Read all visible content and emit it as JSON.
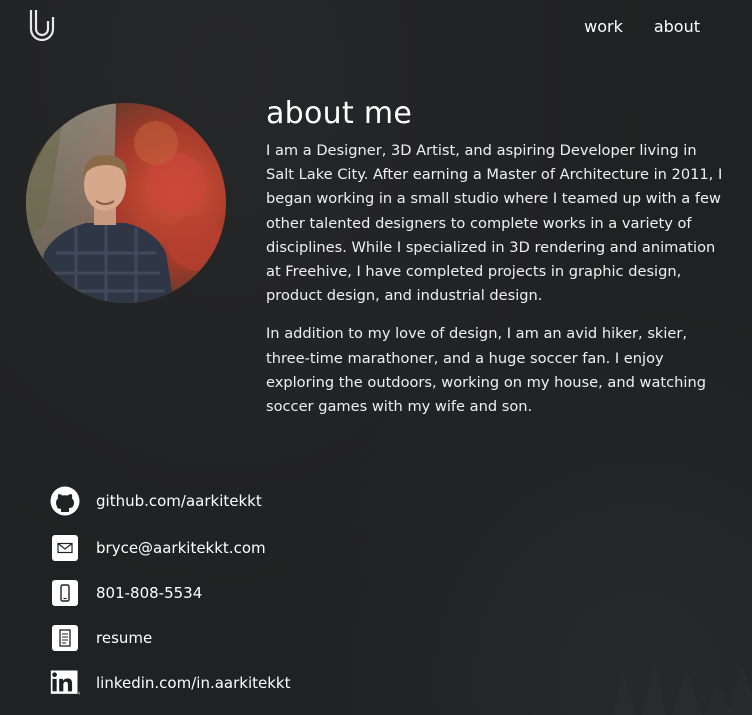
{
  "nav": {
    "logo": "aarkitekkt-logo",
    "links": [
      {
        "label": "work"
      },
      {
        "label": "about"
      }
    ]
  },
  "about": {
    "heading": "about me",
    "paragraphs": [
      "I am a Designer, 3D Artist, and aspiring Developer living in Salt Lake City. After earning a Master of Architecture in 2011, I began working in a small studio where I teamed up with a few other talented designers to complete works in a variety of disciplines. While I specialized in 3D rendering and animation at Freehive, I have completed projects in graphic design, product design, and industrial design.",
      "In addition to my love of design, I am an avid hiker, skier, three-time marathoner, and a huge soccer fan. I enjoy exploring the outdoors, working on my house, and watching soccer games with my wife and son."
    ]
  },
  "contacts": [
    {
      "icon": "github-icon",
      "label": "github.com/aarkitekkt"
    },
    {
      "icon": "mail-icon",
      "label": "bryce@aarkitekkt.com"
    },
    {
      "icon": "phone-icon",
      "label": "801-808-5534"
    },
    {
      "icon": "document-icon",
      "label": "resume"
    },
    {
      "icon": "linkedin-icon",
      "label": "linkedin.com/in.aarkitekkt"
    }
  ],
  "colors": {
    "background": "#202122",
    "text": "#ffffff"
  }
}
